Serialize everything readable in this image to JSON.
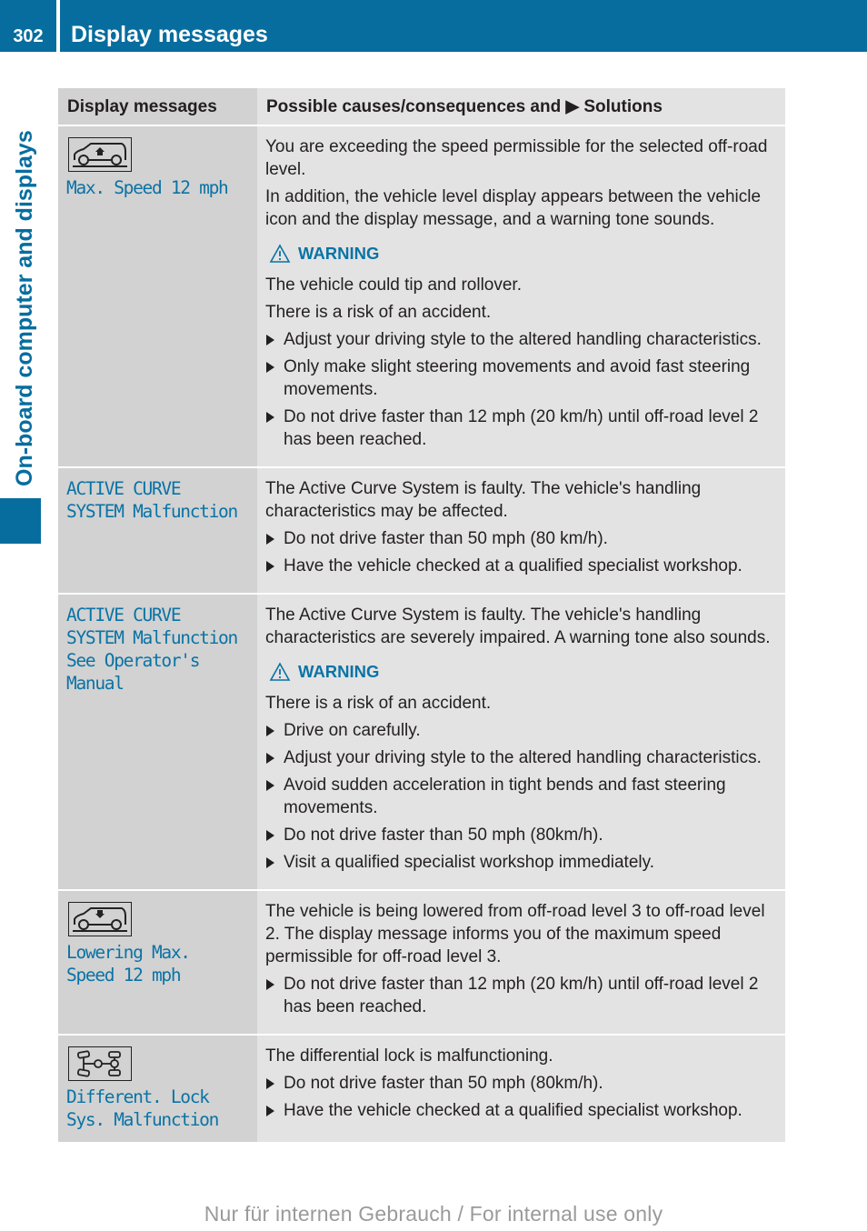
{
  "header": {
    "page_number": "302",
    "title": "Display messages"
  },
  "side_tab": {
    "label": "On-board computer and displays"
  },
  "table": {
    "columns": [
      "Display messages",
      "Possible causes/consequences and ▶ Solutions"
    ],
    "rows": [
      {
        "icon": "vehicle-raise-icon",
        "message": "Max. Speed 12 mph",
        "blocks": [
          {
            "type": "para",
            "text": "You are exceeding the speed permissible for the selected off-road level."
          },
          {
            "type": "para",
            "text": "In addition, the vehicle level display appears between the vehicle icon and the display message, and a warning tone sounds."
          },
          {
            "type": "warning",
            "text": "WARNING"
          },
          {
            "type": "para",
            "text": "The vehicle could tip and rollover."
          },
          {
            "type": "para",
            "text": "There is a risk of an accident."
          },
          {
            "type": "step",
            "text": "Adjust your driving style to the altered handling characteristics."
          },
          {
            "type": "step",
            "text": "Only make slight steering movements and avoid fast steering movements."
          },
          {
            "type": "step",
            "text": "Do not drive faster than 12 mph (20 km/h) until off-road level 2 has been reached."
          }
        ]
      },
      {
        "icon": null,
        "message": "ACTIVE CURVE\nSYSTEM Malfunction",
        "blocks": [
          {
            "type": "para",
            "text": "The Active Curve System is faulty. The vehicle's handling characteristics may be affected."
          },
          {
            "type": "step",
            "text": "Do not drive faster than 50 mph (80 km/h)."
          },
          {
            "type": "step",
            "text": "Have the vehicle checked at a qualified specialist workshop."
          }
        ]
      },
      {
        "icon": null,
        "message": "ACTIVE CURVE\nSYSTEM Malfunction\nSee Operator's\nManual",
        "blocks": [
          {
            "type": "para",
            "text": "The Active Curve System is faulty. The vehicle's handling characteristics are severely impaired. A warning tone also sounds."
          },
          {
            "type": "warning",
            "text": "WARNING"
          },
          {
            "type": "para",
            "text": "There is a risk of an accident."
          },
          {
            "type": "step",
            "text": "Drive on carefully."
          },
          {
            "type": "step",
            "text": "Adjust your driving style to the altered handling characteristics."
          },
          {
            "type": "step",
            "text": "Avoid sudden acceleration in tight bends and fast steering movements."
          },
          {
            "type": "step",
            "text": "Do not drive faster than 50 mph (80km/h)."
          },
          {
            "type": "step",
            "text": "Visit a qualified specialist workshop immediately."
          }
        ]
      },
      {
        "icon": "vehicle-lower-icon",
        "message": "Lowering Max.\nSpeed 12 mph",
        "blocks": [
          {
            "type": "para",
            "text": "The vehicle is being lowered from off-road level 3 to off-road level 2. The display message informs you of the maximum speed permissible for off-road level 3."
          },
          {
            "type": "step",
            "text": "Do not drive faster than 12 mph (20 km/h) until off-road level 2 has been reached."
          }
        ]
      },
      {
        "icon": "differential-lock-icon",
        "message": "Different. Lock\nSys. Malfunction",
        "blocks": [
          {
            "type": "para",
            "text": "The differential lock is malfunctioning."
          },
          {
            "type": "step",
            "text": "Do not drive faster than 50 mph (80km/h)."
          },
          {
            "type": "step",
            "text": "Have the vehicle checked at a qualified specialist workshop."
          }
        ]
      }
    ]
  },
  "footer": {
    "watermark": "Nur für internen Gebrauch / For internal use only"
  },
  "colors": {
    "brand_blue": "#076d9f",
    "message_blue": "#0a73a5",
    "header_gray": "#d2d2d2",
    "cell_gray": "#e3e3e3"
  }
}
